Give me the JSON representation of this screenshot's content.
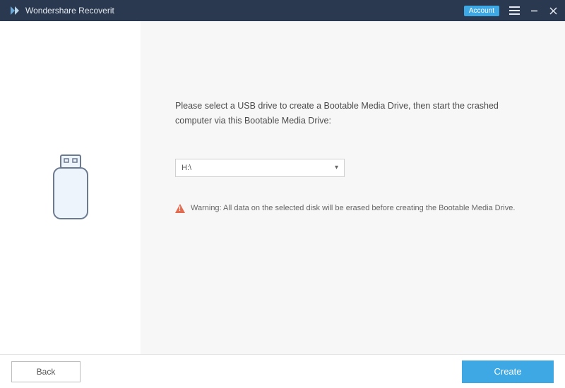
{
  "titlebar": {
    "app_name": "Wondershare Recoverit",
    "account_label": "Account"
  },
  "main": {
    "instruction": "Please select a USB drive to create a Bootable Media Drive, then start the crashed computer via this Bootable Media Drive:",
    "selected_drive": "H:\\",
    "warning": "Warning: All data on the selected disk will be erased before creating the Bootable Media Drive."
  },
  "footer": {
    "back_label": "Back",
    "create_label": "Create"
  }
}
